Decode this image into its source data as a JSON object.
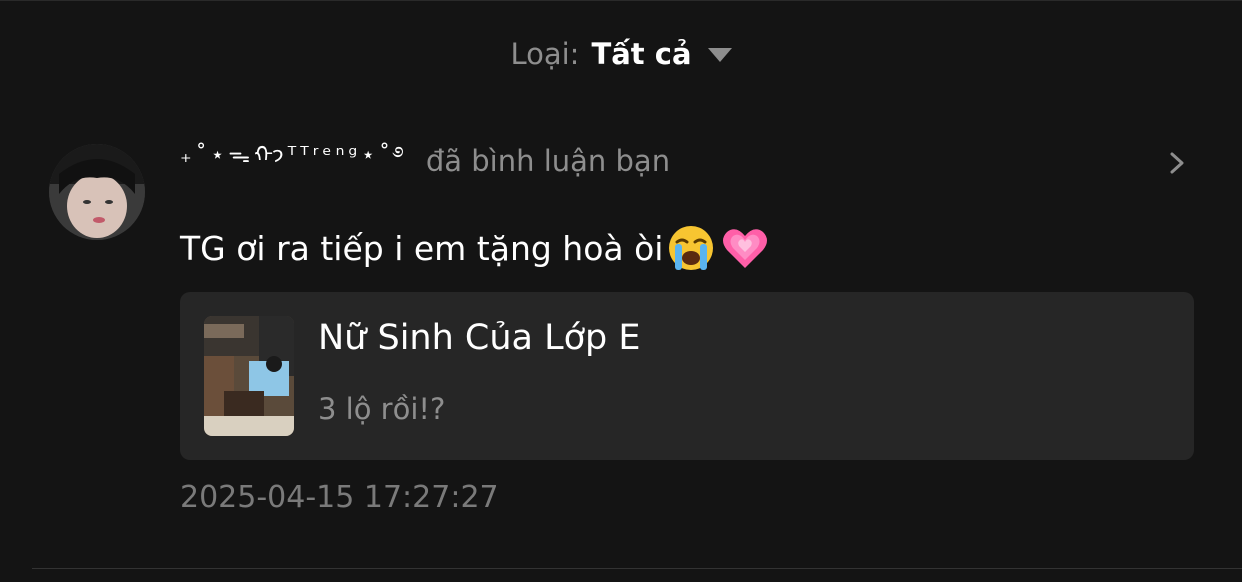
{
  "filter": {
    "label": "Loại:",
    "value": "Tất cả"
  },
  "notification": {
    "username": "₊˚⋆ᯓᡣ𐭩ᵀᵀʳᵉⁿᵍ⋆˚࿔",
    "action": "đã bình luận bạn",
    "comment": "TG ơi ra tiếp i em tặng hoà òi",
    "emojis": [
      "loudly-crying-face",
      "growing-heart"
    ],
    "story": {
      "title": "Nữ Sinh Của Lớp E",
      "chapter": "3 lộ rồi!?"
    },
    "timestamp": "2025-04-15 17:27:27"
  },
  "colors": {
    "background": "#141414",
    "card": "#262626",
    "muted_text": "#8e8e8e",
    "primary_text": "#ffffff",
    "heart": "#ff5fa8"
  }
}
